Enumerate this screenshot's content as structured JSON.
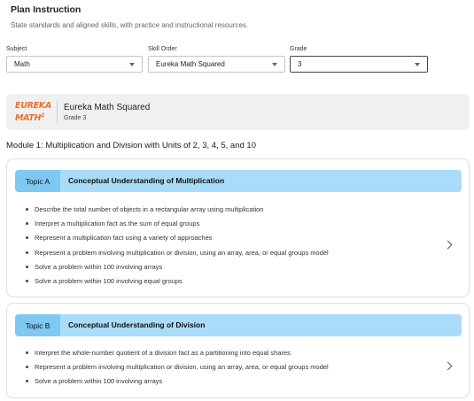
{
  "header": {
    "title": "Plan Instruction",
    "subtitle": "State standards and aligned skills, with practice and instructional resources."
  },
  "filters": {
    "subject": {
      "label": "Subject",
      "value": "Math"
    },
    "skill_order": {
      "label": "Skill Order",
      "value": "Eureka Math Squared"
    },
    "grade": {
      "label": "Grade",
      "value": "3"
    }
  },
  "program": {
    "logo_line1": "EUREKA",
    "logo_line2": "MATH",
    "logo_sup": "2",
    "name": "Eureka Math Squared",
    "grade": "Grade 3"
  },
  "module": {
    "title": "Module 1: Multiplication and Division with Units of 2, 3, 4, 5, and 10"
  },
  "topics": [
    {
      "tag": "Topic A",
      "title": "Conceptual Understanding of Multiplication",
      "skills": [
        "Describe the total number of objects in a rectangular array using multiplication",
        "Interpret a multiplication fact as the sum of equal groups",
        "Represent a multiplication fact using a variety of approaches",
        "Represent a problem involving multiplication or division, using an array, area, or equal groups model",
        "Solve a problem within 100 involving arrays",
        "Solve a problem within 100 involving equal groups"
      ]
    },
    {
      "tag": "Topic B",
      "title": "Conceptual Understanding of Division",
      "skills": [
        "Interpret the whole-number quotient of a division fact as a partitioning into equal shares",
        "Represent a problem involving multiplication or division, using an array, area, or equal groups model",
        "Solve a problem within 100 involving arrays"
      ]
    }
  ],
  "colors": {
    "logo_orange": "#e8702a",
    "topic_header": "#a9dcf8",
    "topic_tag": "#7ec8f2"
  }
}
